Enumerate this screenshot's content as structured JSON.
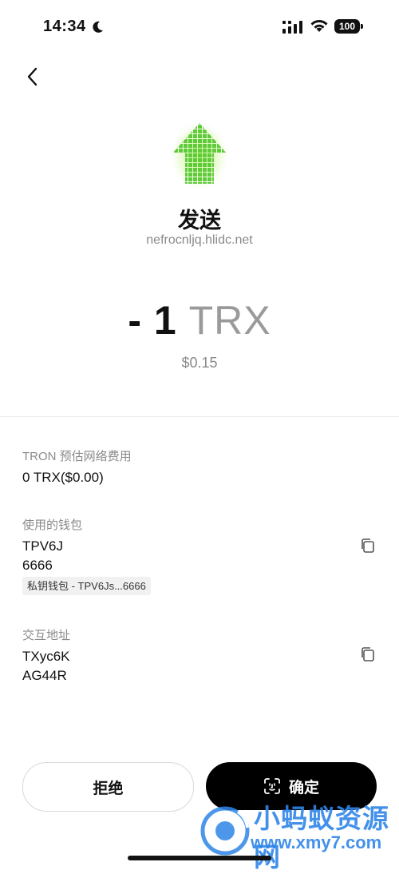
{
  "status_bar": {
    "time": "14:34",
    "battery": "100"
  },
  "header": {
    "title": "发送",
    "origin": "nefrocnljq.hlidc.net"
  },
  "amount": {
    "value": "- 1",
    "symbol": "TRX",
    "fiat": "$0.15"
  },
  "fee": {
    "label": "TRON 预估网络费用",
    "value": "0 TRX($0.00)"
  },
  "wallet": {
    "label": "使用的钱包",
    "address_line1": "TPV6J",
    "address_line2": "6666",
    "tag": "私钥钱包 - TPV6Js...6666"
  },
  "interaction": {
    "label": "交互地址",
    "address_line1": "TXyc6K",
    "address_line2": "AG44R"
  },
  "actions": {
    "reject": "拒绝",
    "confirm": "确定"
  },
  "watermark": {
    "title": "小蚂蚁资源网",
    "url": "www.xmy7.com"
  }
}
